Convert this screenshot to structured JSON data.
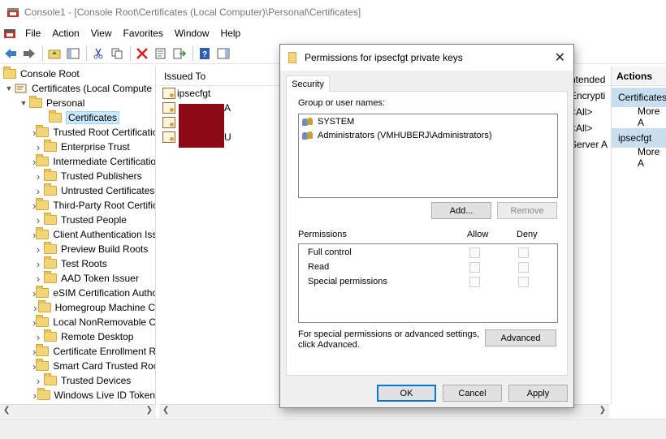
{
  "window": {
    "title": "Console1 - [Console Root\\Certificates (Local Computer)\\Personal\\Certificates]"
  },
  "menu": [
    "File",
    "Action",
    "View",
    "Favorites",
    "Window",
    "Help"
  ],
  "tree": {
    "root": "Console Root",
    "computer": "Certificates (Local Compute",
    "personal": "Personal",
    "certificates": "Certificates",
    "stores": [
      "Trusted Root Certificatio",
      "Enterprise Trust",
      "Intermediate Certificatio",
      "Trusted Publishers",
      "Untrusted Certificates",
      "Third-Party Root Certific",
      "Trusted People",
      "Client Authentication Iss",
      "Preview Build Roots",
      "Test Roots",
      "AAD Token Issuer",
      "eSIM Certification Autho",
      "Homegroup Machine C",
      "Local NonRemovable Ce",
      "Remote Desktop",
      "Certificate Enrollment R",
      "Smart Card Trusted Roo",
      "Trusted Devices",
      "Windows Live ID Token"
    ]
  },
  "list": {
    "header": "Issued To",
    "first_item": "ipsecfgt",
    "partial_chars": [
      "A",
      "U"
    ],
    "right_column": [
      "ntended",
      "Encrypti",
      "<All>",
      "<All>",
      "Server A"
    ]
  },
  "actions": {
    "header": "Actions",
    "section1": "Certificates",
    "more1": "More A",
    "section2": "ipsecfgt",
    "more2": "More A"
  },
  "dialog": {
    "title": "Permissions for ipsecfgt private keys",
    "tab": "Security",
    "group_label": "Group or user names:",
    "users": [
      "SYSTEM",
      "Administrators (VMHUBERJ\\Administrators)"
    ],
    "add_label": "Add...",
    "remove_label": "Remove",
    "permissions_label": "Permissions",
    "allow_label": "Allow",
    "deny_label": "Deny",
    "permissions": [
      "Full control",
      "Read",
      "Special permissions"
    ],
    "special_text_1": "For special permissions or advanced settings,",
    "special_text_2": "click Advanced.",
    "advanced_label": "Advanced",
    "ok_label": "OK",
    "cancel_label": "Cancel",
    "apply_label": "Apply"
  }
}
